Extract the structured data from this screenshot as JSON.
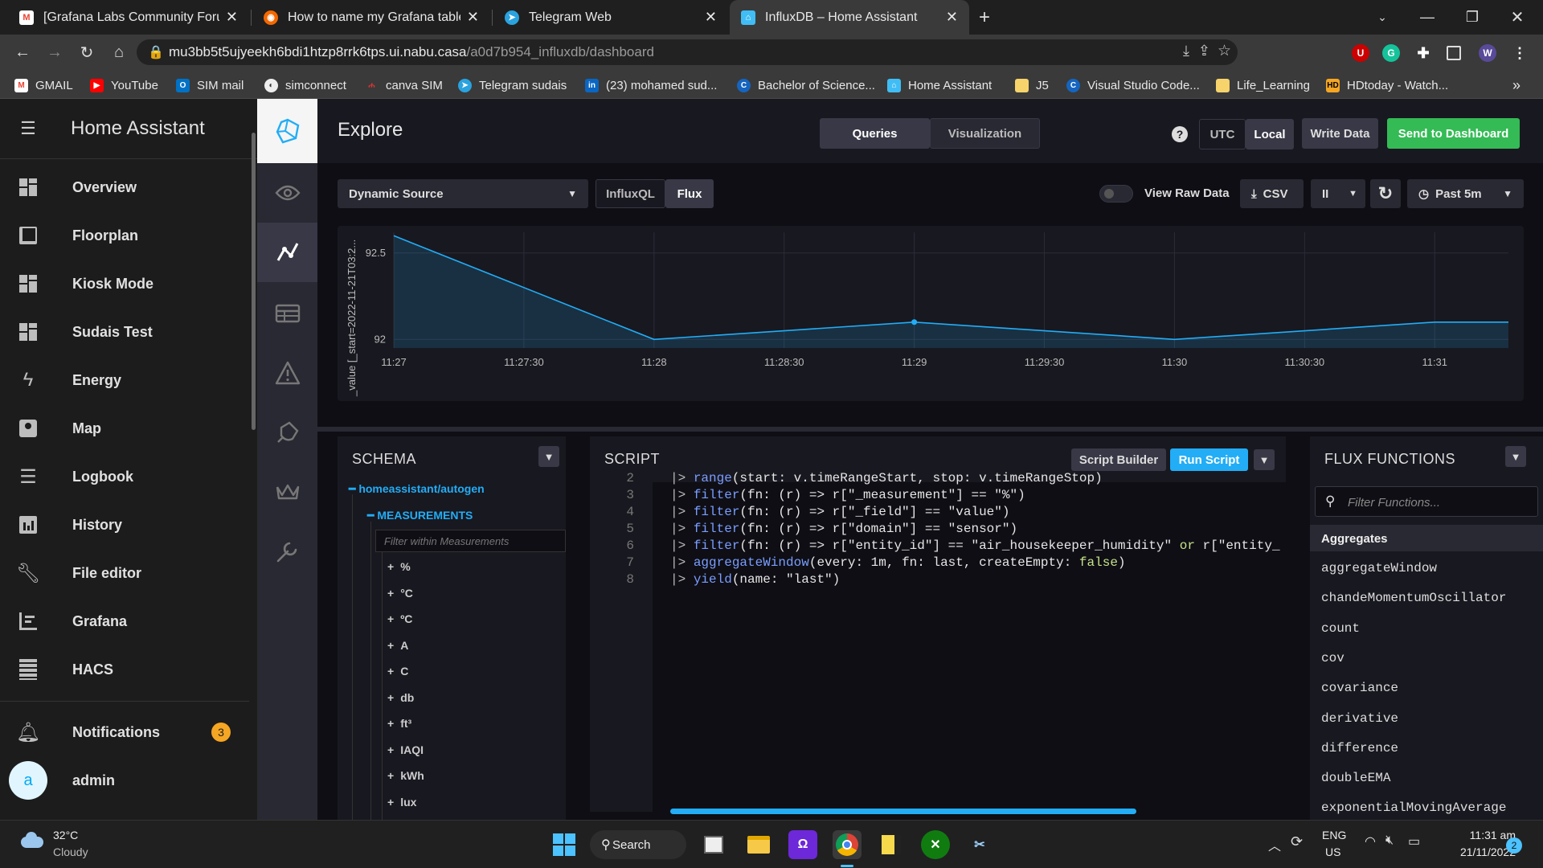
{
  "browser": {
    "tabs": [
      {
        "title": "[Grafana Labs Community Forums]",
        "icon": "gmail-icon"
      },
      {
        "title": "How to name my Grafana table R",
        "icon": "grafana-icon"
      },
      {
        "title": "Telegram Web",
        "icon": "telegram-icon"
      },
      {
        "title": "InfluxDB – Home Assistant",
        "icon": "home-assistant-icon",
        "active": true
      }
    ],
    "url_host": "mu3bb5t5ujyeekh6bdi1htzp8rrk6tps.ui.nabu.casa",
    "url_path": "/a0d7b954_influxdb/dashboard",
    "bookmarks": [
      "GMAIL",
      "YouTube",
      "SIM mail",
      "simconnect",
      "canva SIM",
      "Telegram sudais",
      "(23) mohamed sud...",
      "Bachelor of Science...",
      "Home Assistant",
      "J5",
      "Visual Studio Code...",
      "Life_Learning",
      "HDtoday - Watch..."
    ],
    "more_bookmarks": "»"
  },
  "ha_sidebar": {
    "title": "Home Assistant",
    "items": [
      {
        "label": "Overview",
        "icon": "dashboard-icon"
      },
      {
        "label": "Floorplan",
        "icon": "floorplan-icon"
      },
      {
        "label": "Kiosk Mode",
        "icon": "dashboard-icon"
      },
      {
        "label": "Sudais Test",
        "icon": "dashboard-icon"
      },
      {
        "label": "Energy",
        "icon": "lightning-icon"
      },
      {
        "label": "Map",
        "icon": "map-icon"
      },
      {
        "label": "Logbook",
        "icon": "list-icon"
      },
      {
        "label": "History",
        "icon": "chart-icon"
      },
      {
        "label": "File editor",
        "icon": "wrench-icon"
      },
      {
        "label": "Grafana",
        "icon": "grafana-panel-icon"
      },
      {
        "label": "HACS",
        "icon": "hacs-icon"
      }
    ],
    "notifications": {
      "label": "Notifications",
      "count": "3"
    },
    "user": {
      "label": "admin",
      "initial": "a"
    }
  },
  "explore": {
    "title": "Explore",
    "mode_tabs": [
      "Queries",
      "Visualization"
    ],
    "help": "?",
    "tz": [
      "UTC",
      "Local"
    ],
    "write_data": "Write Data",
    "send_dashboard": "Send to Dashboard",
    "source": "Dynamic Source",
    "lang": [
      "InfluxQL",
      "Flux"
    ],
    "raw_data": "View Raw Data",
    "csv": "CSV",
    "pause": "II",
    "range": "Past 5m"
  },
  "chart_data": {
    "type": "line",
    "ylabel": "_value [_start=2022-11-21T03:2...",
    "x_ticks": [
      "11:27",
      "11:27:30",
      "11:28",
      "11:28:30",
      "11:29",
      "11:29:30",
      "11:30",
      "11:30:30",
      "11:31"
    ],
    "y_ticks": [
      "92.5",
      "92"
    ],
    "ylim": [
      91.95,
      92.62
    ],
    "points": [
      {
        "x": "11:27:00",
        "y": 92.6
      },
      {
        "x": "11:28:00",
        "y": 92.0
      },
      {
        "x": "11:29:00",
        "y": 92.1
      },
      {
        "x": "11:30:00",
        "y": 92.0
      },
      {
        "x": "11:31:00",
        "y": 92.1
      },
      {
        "x": "11:31:17",
        "y": 92.1
      }
    ],
    "line_color": "#22adf6",
    "grid": true
  },
  "schema": {
    "title": "SCHEMA",
    "bucket": "homeassistant/autogen",
    "group": "MEASUREMENTS",
    "filter_placeholder": "Filter within Measurements",
    "measurements": [
      "%",
      "°C",
      "ºC",
      "A",
      "C",
      "db",
      "ft³",
      "IAQI",
      "kWh",
      "lux"
    ]
  },
  "script": {
    "title": "SCRIPT",
    "builder": "Script Builder",
    "run": "Run Script",
    "lines": [
      {
        "n": "2",
        "text": "|> range(start: v.timeRangeStart, stop: v.timeRangeStop)"
      },
      {
        "n": "3",
        "text": "|> filter(fn: (r) => r[\"_measurement\"] == \"%\")"
      },
      {
        "n": "4",
        "text": "|> filter(fn: (r) => r[\"_field\"] == \"value\")"
      },
      {
        "n": "5",
        "text": "|> filter(fn: (r) => r[\"domain\"] == \"sensor\")"
      },
      {
        "n": "6",
        "text": "|> filter(fn: (r) => r[\"entity_id\"] == \"air_housekeeper_humidity\" or r[\"entity_"
      },
      {
        "n": "7",
        "text": "|> aggregateWindow(every: 1m, fn: last, createEmpty: false)"
      },
      {
        "n": "8",
        "text": "|> yield(name: \"last\")"
      }
    ]
  },
  "flux_functions": {
    "title": "FLUX FUNCTIONS",
    "placeholder": "Filter Functions...",
    "category": "Aggregates",
    "items": [
      "aggregateWindow",
      "chandeMomentumOscillator",
      "count",
      "cov",
      "covariance",
      "derivative",
      "difference",
      "doubleEMA",
      "exponentialMovingAverage"
    ]
  },
  "taskbar": {
    "weather_temp": "32°C",
    "weather_desc": "Cloudy",
    "search": "Search",
    "lang1": "ENG",
    "lang2": "US",
    "time": "11:31 am",
    "date": "21/11/2022",
    "notif_count": "2"
  }
}
